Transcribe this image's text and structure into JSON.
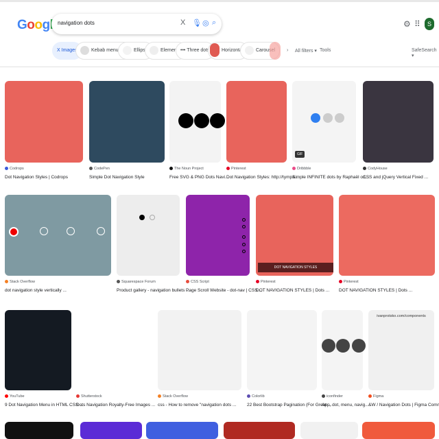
{
  "header": {
    "logo": "Google",
    "query": "navigation dots",
    "clear_icon": "X",
    "profile_initial": "S"
  },
  "chips": [
    {
      "label": "Images",
      "active": true,
      "prefix": "X"
    },
    {
      "label": "Kebab menu icon"
    },
    {
      "label": "Ellipsis"
    },
    {
      "label": "Elementor"
    },
    {
      "label": "Three dots",
      "prefix": "•••"
    },
    {
      "label": "Horizontal"
    },
    {
      "label": "Carousel"
    }
  ],
  "toolbar": {
    "next": "›",
    "all_filters": "All filters ▾",
    "tools": "Tools",
    "safesearch": "SafeSearch ▾"
  },
  "results": [
    {
      "source": "Codrops",
      "title": "Dot Navigation Styles | Codrops",
      "color": "#e8645c"
    },
    {
      "source": "CodePen",
      "title": "Simple Dot Navigation Style",
      "color": "#2e4a5f"
    },
    {
      "source": "The Noun Project",
      "title": "Free SVG & PNG Dots Navi...",
      "color": "#f3f3f3"
    },
    {
      "source": "Pinterest",
      "title": "Dot Navigation Styles: http://tympa...",
      "color": "#e8645c"
    },
    {
      "source": "Dribbble",
      "title": "Simple INFINITE dots by Raphaël on...",
      "color": "#f4f4f4"
    },
    {
      "source": "CodyHouse",
      "title": "CSS and jQuery Vertical Fixed ...",
      "color": "#3a3540"
    },
    {
      "source": "Stack Overflow",
      "title": "dot navigation style vertically ...",
      "color": "#7f9aa2"
    },
    {
      "source": "Squarespace Forum",
      "title": "Product gallery - navigation bullets ...",
      "color": "#ededed"
    },
    {
      "source": "CSS Script",
      "title": "Page Scroll Website - dot-nav | CSS ...",
      "color": "#8e24aa"
    },
    {
      "source": "Pinterest",
      "title": "DOT NAVIGATION STYLES | Dots ...",
      "color": "#e8645c"
    },
    {
      "source": "Pinterest",
      "title": "DOT NAVIGATION STYLES | Dots ...",
      "color": "#ec6a60"
    },
    {
      "source": "YouTube",
      "title": "9 Dot Navigation Menu in HTML CSS ...",
      "color": "#141a22"
    },
    {
      "source": "Shutterstock",
      "title": "Dots Navigation Royalty-Free Images ...",
      "color": "#ffffff"
    },
    {
      "source": "Stack Overflow",
      "title": "css - How to remove \"navigation dots ...",
      "color": "#f2f2f2"
    },
    {
      "source": "Colorlib",
      "title": "22 Best Bootstrap Pagination (For Great ...",
      "color": "#f4f4f4"
    },
    {
      "source": "iconfinder",
      "title": "App, dot, menu, navig...",
      "color": "#f4f4f4"
    },
    {
      "source": "Figma",
      "title": "&W / Navigation Dots | Figma Commu...",
      "color": "#f0f0f0"
    }
  ],
  "overlay_texts": {
    "dribbble_badge": "GIF",
    "pinterest_banner": "DOT NAVIGATION STYLES",
    "figma_url": "ivanprotsko.com/components"
  }
}
